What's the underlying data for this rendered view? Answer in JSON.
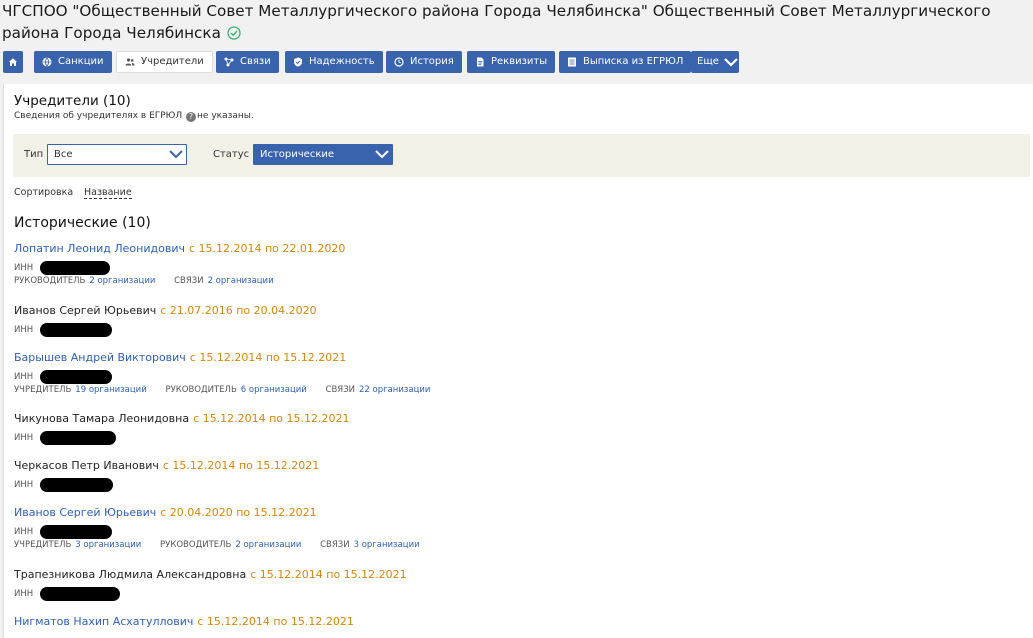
{
  "header": {
    "title": "ЧГСПОО \"Общественный Совет Металлургического района Города Челябинска\" Общественный Совет Металлургического района Города Челябинска"
  },
  "toolbar": {
    "buttons": [
      {
        "label": "",
        "icon": "home-icon"
      },
      {
        "label": "Санкции",
        "icon": "globe-icon"
      },
      {
        "label": "Учредители",
        "icon": "people-icon",
        "active": true
      },
      {
        "label": "Связи",
        "icon": "network-icon"
      },
      {
        "label": "Надежность",
        "icon": "shield-icon"
      },
      {
        "label": "История",
        "icon": "clock-icon"
      },
      {
        "label": "Реквизиты",
        "icon": "document-icon"
      },
      {
        "label": "Выписка из ЕГРЮЛ",
        "icon": "list-icon"
      },
      {
        "label": "Еще",
        "icon": "chevron-down-icon"
      }
    ]
  },
  "founders": {
    "heading": "Учредители (10)",
    "subtitle_before": "Сведения об учредителях в ЕГРЮЛ",
    "info_glyph": "?",
    "subtitle_after": "не указаны."
  },
  "filter": {
    "type_label": "Тип",
    "type_value": "Все",
    "status_label": "Статус",
    "status_value": "Исторические"
  },
  "sort": {
    "label": "Сортировка",
    "value": "Название"
  },
  "historic": {
    "heading": "Исторические (10)",
    "inn_label": "ИНН",
    "items": [
      {
        "name": "Лопатин Леонид Леонидович",
        "link": true,
        "period": "с 15.12.2014 по 22.01.2020",
        "relations": [
          {
            "label": "Руководитель",
            "value": "2 организации"
          },
          {
            "label": "Связи",
            "value": "2 организации"
          }
        ]
      },
      {
        "name": "Иванов Сергей Юрьевич",
        "link": false,
        "period": "с 21.07.2016 по 20.04.2020",
        "relations": []
      },
      {
        "name": "Барышев Андрей Викторович",
        "link": true,
        "period": "с 15.12.2014 по 15.12.2021",
        "relations": [
          {
            "label": "Учредитель",
            "value": "19 организаций"
          },
          {
            "label": "Руководитель",
            "value": "6 организаций"
          },
          {
            "label": "Связи",
            "value": "22 организации"
          }
        ]
      },
      {
        "name": "Чикунова Тамара Леонидовна",
        "link": false,
        "period": "с 15.12.2014 по 15.12.2021",
        "relations": []
      },
      {
        "name": "Черкасов Петр Иванович",
        "link": false,
        "period": "с 15.12.2014 по 15.12.2021",
        "relations": []
      },
      {
        "name": "Иванов Сергей Юрьевич",
        "link": true,
        "period": "с 20.04.2020 по 15.12.2021",
        "relations": [
          {
            "label": "Учредитель",
            "value": "3 организации"
          },
          {
            "label": "Руководитель",
            "value": "2 организации"
          },
          {
            "label": "Связи",
            "value": "3 организации"
          }
        ]
      },
      {
        "name": "Трапезникова Людмила Александровна",
        "link": false,
        "period": "с 15.12.2014 по 15.12.2021",
        "relations": []
      },
      {
        "name": "Нигматов Нахип Асхатуллович",
        "link": true,
        "period": "с 15.12.2014 по 15.12.2021",
        "relations": []
      }
    ]
  }
}
